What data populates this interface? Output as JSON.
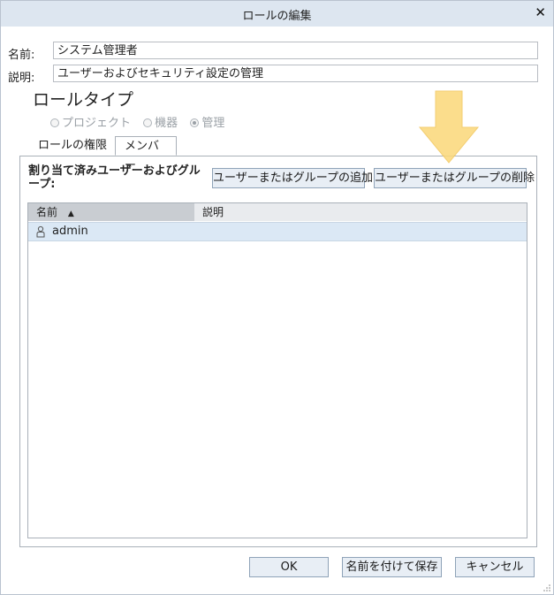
{
  "window": {
    "title": "ロールの編集"
  },
  "form": {
    "name_label": "名前:",
    "name_value": "システム管理者",
    "description_label": "説明:",
    "description_value": "ユーザーおよびセキュリティ設定の管理"
  },
  "role_type": {
    "heading": "ロールタイプ",
    "options": [
      {
        "label": "プロジェクト",
        "checked": false
      },
      {
        "label": "機器",
        "checked": false
      },
      {
        "label": "管理",
        "checked": true
      }
    ]
  },
  "tabs": [
    {
      "label": "ロールの権限",
      "active": false
    },
    {
      "label": "メンバー",
      "active": true
    }
  ],
  "members": {
    "assigned_label": "割り当て済みユーザーおよびグループ:",
    "add_button": "ユーザーまたはグループの追加",
    "remove_button": "ユーザーまたはグループの削除",
    "columns": [
      {
        "label": "名前",
        "sort": "ascending"
      },
      {
        "label": "説明"
      }
    ],
    "rows": [
      {
        "name": "admin",
        "description": "",
        "icon": "user-icon",
        "selected": true
      }
    ]
  },
  "footer": {
    "ok_button": "OK",
    "save_as_button": "名前を付けて保存",
    "cancel_button": "キャンセル"
  },
  "colors": {
    "titlebar": "#dde6f0",
    "button_bg": "#e8eef5",
    "selected_row": "#dbe8f5",
    "arrow": "#fbd878"
  }
}
